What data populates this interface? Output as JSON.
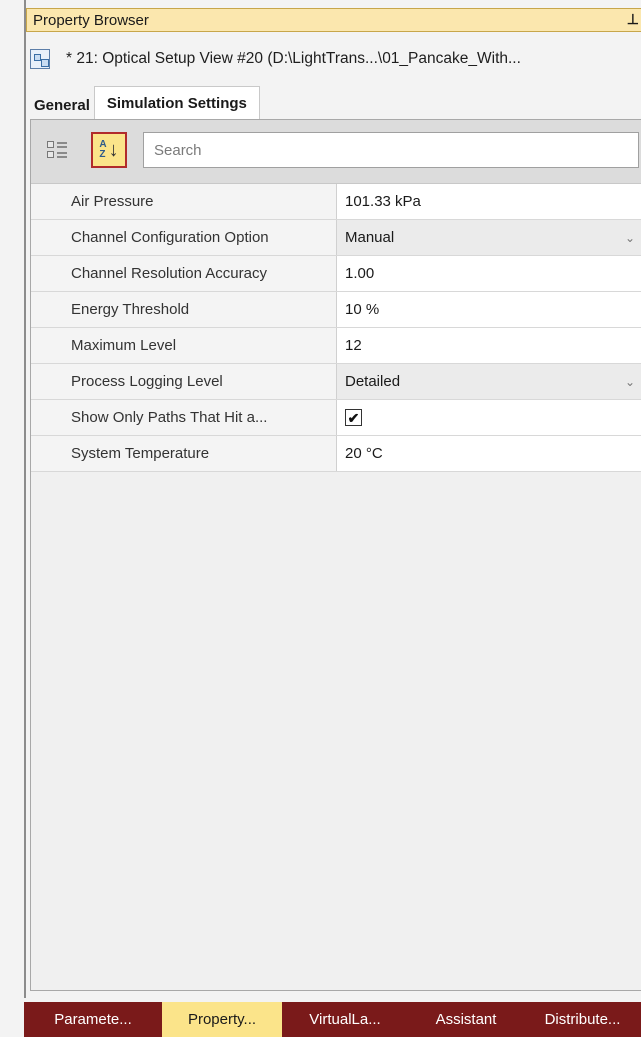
{
  "window": {
    "title": "Property Browser",
    "pin_icon": "pin-icon",
    "document_line": "* 21: Optical Setup View #20 (D:\\LightTrans...\\01_Pancake_With..."
  },
  "tabs": [
    {
      "label": "General",
      "active": false
    },
    {
      "label": "Simulation Settings",
      "active": true
    }
  ],
  "toolbar": {
    "categorized_icon": "categorized-view-icon",
    "sort_icon": "sort-alphabetical-icon",
    "sort_letters_top": "A",
    "sort_letters_bottom": "Z",
    "sort_arrow": "↓",
    "search_placeholder": "Search"
  },
  "properties": [
    {
      "name": "Air Pressure",
      "value": "101.33 kPa",
      "type": "text"
    },
    {
      "name": "Channel Configuration Option",
      "value": "Manual",
      "type": "dropdown"
    },
    {
      "name": "Channel Resolution Accuracy",
      "value": "1.00",
      "type": "text"
    },
    {
      "name": "Energy Threshold",
      "value": "10 %",
      "type": "text"
    },
    {
      "name": "Maximum Level",
      "value": "12",
      "type": "text"
    },
    {
      "name": "Process Logging Level",
      "value": "Detailed",
      "type": "dropdown"
    },
    {
      "name": "Show Only Paths That Hit a...",
      "value": "✔",
      "type": "checkbox",
      "checked": true
    },
    {
      "name": "System Temperature",
      "value": "20 °C",
      "type": "text"
    }
  ],
  "bottom_tabs": [
    {
      "label": "Paramete...",
      "active": false
    },
    {
      "label": "Property...",
      "active": true
    },
    {
      "label": "VirtualLa...",
      "active": false
    },
    {
      "label": "Assistant",
      "active": false
    },
    {
      "label": "Distribute...",
      "active": false
    }
  ],
  "colors": {
    "titlebar": "#fbe7ae",
    "accent_active": "#fbe48a",
    "tab_dark": "#7a1a1a",
    "highlight_border": "#b12b2b"
  }
}
